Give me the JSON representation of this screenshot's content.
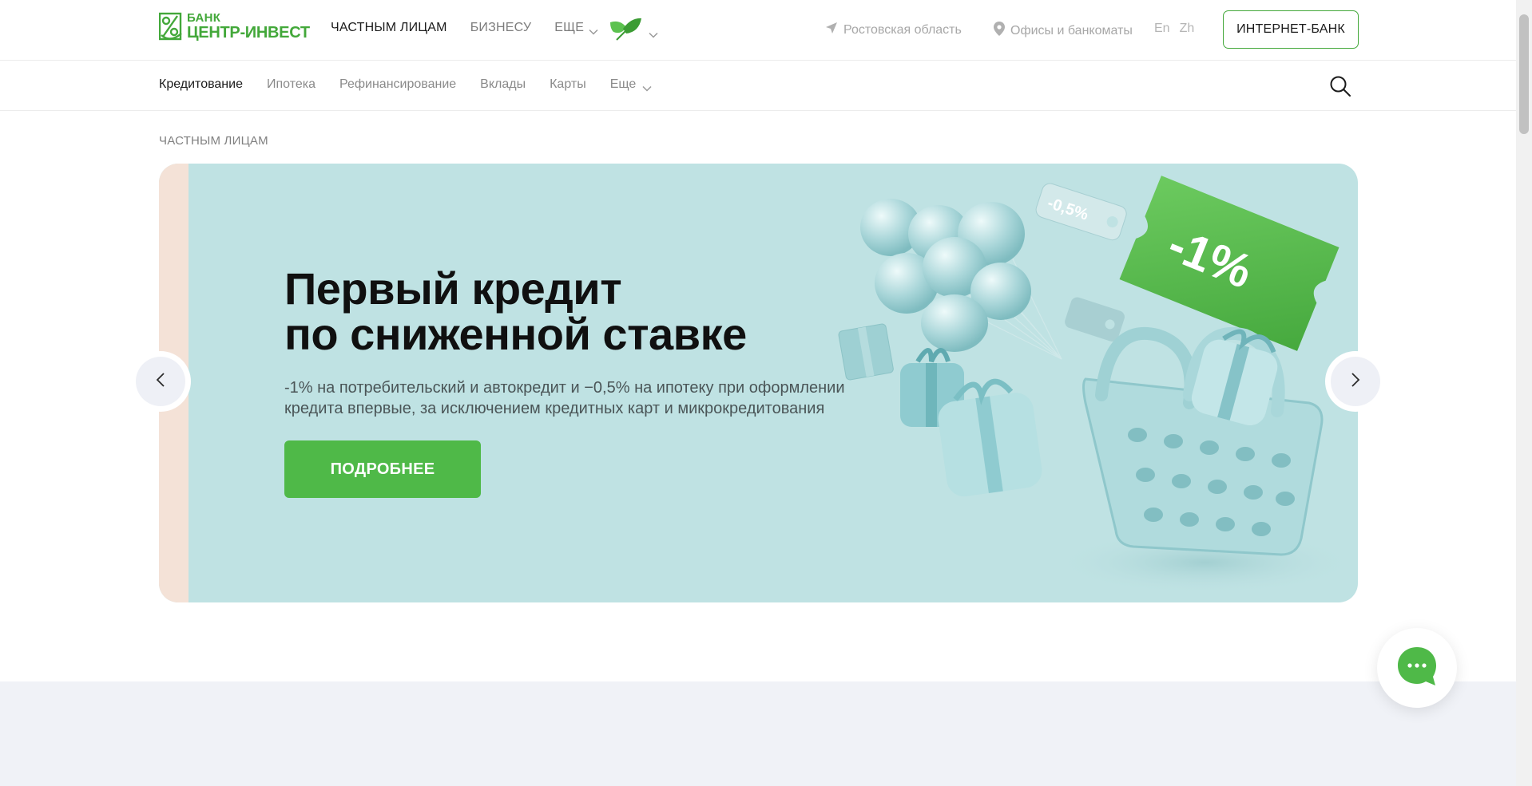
{
  "header": {
    "logo": {
      "line1": "БАНК",
      "line2": "ЦЕНТР-ИНВЕСТ",
      "brand_color": "#43a83a"
    },
    "nav": [
      {
        "label": "ЧАСТНЫМ ЛИЦАМ",
        "active": true
      },
      {
        "label": "БИЗНЕСУ",
        "active": false
      },
      {
        "label": "ЕЩЕ",
        "active": false,
        "dropdown": true
      }
    ],
    "region": {
      "label": "Ростовская область",
      "icon": "navigation-arrow-icon"
    },
    "offices": {
      "label": "Офисы и банкоматы",
      "icon": "map-pin-icon"
    },
    "languages": [
      "En",
      "Zh"
    ],
    "internet_bank_button": "ИНТЕРНЕТ-БАНК"
  },
  "subnav": {
    "items": [
      {
        "label": "Кредитование",
        "active": true
      },
      {
        "label": "Ипотека",
        "active": false
      },
      {
        "label": "Рефинансирование",
        "active": false
      },
      {
        "label": "Вклады",
        "active": false
      },
      {
        "label": "Карты",
        "active": false
      },
      {
        "label": "Еще",
        "active": false,
        "dropdown": true
      }
    ]
  },
  "breadcrumb": "ЧАСТНЫМ ЛИЦАМ",
  "hero": {
    "title_line1": "Первый кредит",
    "title_line2": "по сниженной ставке",
    "subtitle": "-1% на потребительский и автокредит и −0,5% на ипотеку при оформлении кредита впервые, за исключением кредитных карт и микрокредитования",
    "cta": "ПОДРОБНЕЕ",
    "coupon_big": "-1%",
    "coupon_small": "-0,5%",
    "colors": {
      "background": "#bfe2e3",
      "side_strip": "#f4e2d7",
      "cta": "#4fb948"
    }
  },
  "slider": {
    "prev_icon": "chevron-left-icon",
    "next_icon": "chevron-right-icon"
  },
  "chat": {
    "icon": "chat-bubble-icon",
    "color": "#4fb948"
  }
}
